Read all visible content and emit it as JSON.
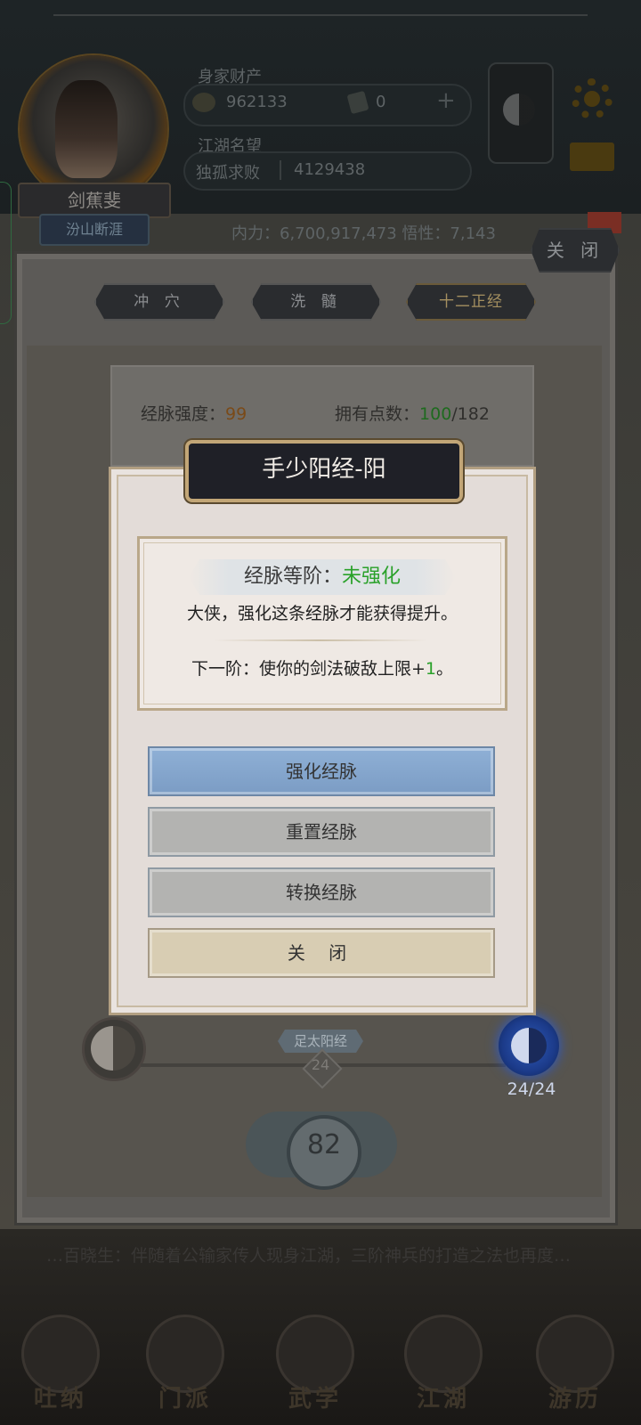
{
  "header": {
    "wealth_label": "身家财产",
    "coins": "962133",
    "tickets": "0",
    "plus": "+",
    "reputation_label": "江湖名望",
    "title": "独孤求败",
    "reputation": "4129438",
    "character_name": "剑蕉斐",
    "sect": "汾山断涯",
    "stats": "内力：6,700,917,473   悟性：7,143"
  },
  "top_close": "关 闭",
  "tabs": [
    "冲 穴",
    "洗 髓",
    "十二正经"
  ],
  "info": {
    "strength_label": "经脉强度：",
    "strength_value": "99",
    "points_label": "拥有点数：",
    "points_have": "100",
    "points_total": "/182"
  },
  "dialog": {
    "title": "手少阳经-阳",
    "grade_label": "经脉等阶：",
    "grade_value": "未强化",
    "hint": "大侠，强化这条经脉才能获得提升。",
    "next_prefix": "下一阶：使你的剑法破敌上限+",
    "next_value": "1",
    "next_suffix": "。",
    "buttons": {
      "strengthen": "强化经脉",
      "reset": "重置经脉",
      "convert": "转换经脉",
      "close": "关 闭"
    }
  },
  "meridian": {
    "tag": "足太阳经",
    "node_value": "24",
    "progress": "24/24",
    "level": "82"
  },
  "bottom_text": "…百晓生：伴随着公输家传人现身江湖，三阶神兵的打造之法也再度…",
  "nav": [
    "吐纳",
    "门派",
    "武学",
    "江湖",
    "游历"
  ],
  "colors": {
    "accent_green": "#2aa12a",
    "strength_orange": "#a36a2a",
    "primary_button": "#8fb0d6"
  }
}
